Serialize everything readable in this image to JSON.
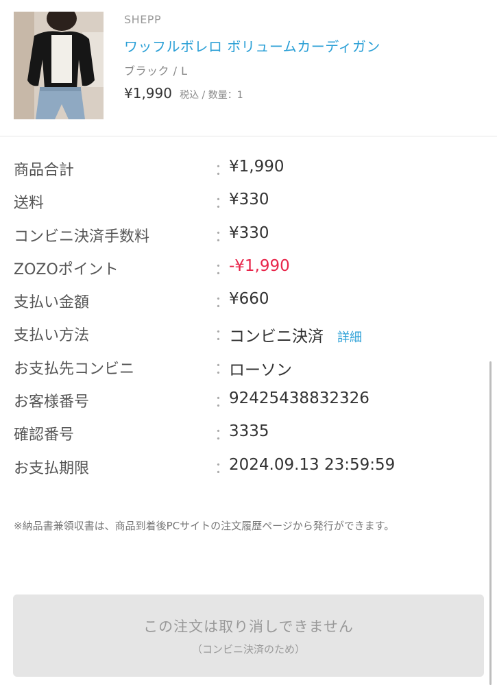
{
  "product": {
    "brand": "SHEPP",
    "name": "ワッフルボレロ ボリュームカーディガン",
    "variant": "ブラック / L",
    "price": "¥1,990",
    "tax_qty": "税込 / 数量：1"
  },
  "rows": [
    {
      "label": "商品合計",
      "value": "¥1,990"
    },
    {
      "label": "送料",
      "value": "¥330"
    },
    {
      "label": "コンビニ決済手数料",
      "value": "¥330"
    },
    {
      "label": "ZOZOポイント",
      "value": "-¥1,990"
    },
    {
      "label": "支払い金額",
      "value": "¥660"
    },
    {
      "label": "支払い方法",
      "value": "コンビニ決済",
      "link": "詳細"
    },
    {
      "label": "お支払先コンビニ",
      "value": "ローソン"
    },
    {
      "label": "お客様番号",
      "value": "92425438832326"
    },
    {
      "label": "確認番号",
      "value": "3335"
    },
    {
      "label": "お支払期限",
      "value": "2024.09.13 23:59:59"
    }
  ],
  "colon": "：",
  "note": "※納品書兼領収書は、商品到着後PCサイトの注文履歴ページから発行ができます。",
  "cancel": {
    "label": "この注文は取り消しできません",
    "sub": "（コンビニ決済のため）"
  },
  "colors": {
    "link": "#2a9fd6",
    "negative": "#e8254a",
    "disabled_button": "#e5e5e5"
  }
}
